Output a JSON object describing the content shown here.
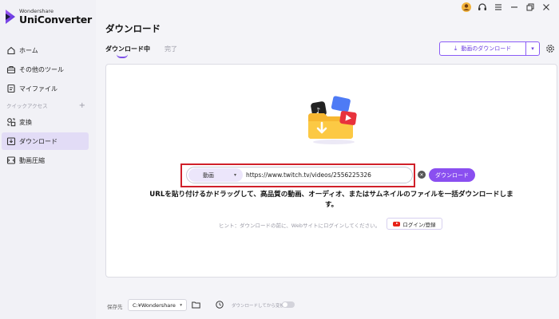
{
  "app": {
    "brand": "Wondershare",
    "product": "UniConverter"
  },
  "sidebar": {
    "items": [
      {
        "label": "ホーム",
        "icon": "home-icon"
      },
      {
        "label": "その他のツール",
        "icon": "toolbox-icon"
      },
      {
        "label": "マイファイル",
        "icon": "file-icon"
      }
    ],
    "section": {
      "label": "クイックアクセス",
      "add": "+"
    },
    "quick_items": [
      {
        "label": "変換",
        "icon": "convert-icon"
      },
      {
        "label": "ダウンロード",
        "icon": "download-icon",
        "active": true
      },
      {
        "label": "動画圧縮",
        "icon": "compress-icon"
      }
    ]
  },
  "page": {
    "title": "ダウンロード",
    "tabs": [
      {
        "label": "ダウンロード中",
        "active": true
      },
      {
        "label": "完了",
        "active": false
      }
    ],
    "download_video_button": "動画のダウンロード"
  },
  "url_bar": {
    "type_option": "動画",
    "url": "https://www.twitch.tv/videos/2556225326",
    "download_button": "ダウンロード"
  },
  "description": "URLを貼り付けるかドラッグして、高品質の動画、オーディオ、またはサムネイルのファイルを一括ダウンロードします。",
  "hint": "ヒント：ダウンロードの前に、Webサイトにログインしてください。",
  "login_button": "ログイン/登録",
  "bottom": {
    "save_label": "保存先",
    "save_path": "C:¥Wondershare",
    "convert_after_label": "ダウンロードしてから変換"
  },
  "colors": {
    "accent": "#8a4ff0",
    "highlight_frame": "#d0202a",
    "active_nav": "#e2dcf6"
  }
}
